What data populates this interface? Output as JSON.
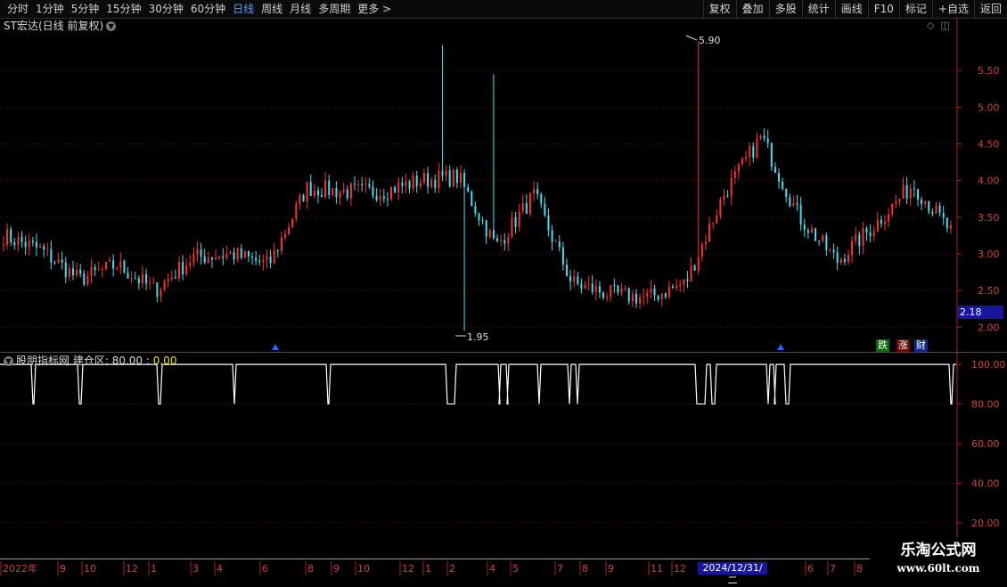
{
  "toolbar": {
    "periods": [
      "分时",
      "1分钟",
      "5分钟",
      "15分钟",
      "30分钟",
      "60分钟",
      "日线",
      "周线",
      "月线",
      "多周期",
      "更多 >"
    ],
    "active_period": "日线",
    "actions": [
      "复权",
      "叠加",
      "多股",
      "统计",
      "画线",
      "F10",
      "标记",
      "+自选",
      "返回"
    ]
  },
  "main_chart": {
    "title": "ST宏达(日线 前复权)",
    "price_axis": [
      "5.50",
      "5.00",
      "4.50",
      "4.00",
      "3.50",
      "3.00",
      "2.50",
      "2.00"
    ],
    "high_label": "5.90",
    "low_label": "1.95",
    "current_price": "2.18",
    "tags": [
      "跌",
      "涨",
      "财"
    ]
  },
  "indicator": {
    "name": "股朋指标网",
    "label": "建仓区: 80.00",
    "sep": " : ",
    "value": "0.00",
    "axis": [
      "100.00",
      "80.00",
      "60.00",
      "40.00",
      "20.00"
    ]
  },
  "time_axis": {
    "labels": [
      "2022年",
      "9",
      "10",
      "12",
      "1",
      "3",
      "4",
      "6",
      "8",
      "9",
      "10",
      "12",
      "1",
      "2",
      "4",
      "5",
      "7",
      "8",
      "9",
      "11",
      "12",
      "6",
      "7",
      "8"
    ],
    "cursor_date": "2024/12/31/二"
  },
  "watermark": {
    "line1": "乐淘公式网",
    "line2": "www.60lt.com"
  },
  "chart_data": [
    {
      "type": "candlestick",
      "title": "ST宏达(日线 前复权)",
      "ylim": [
        1.7,
        6.0
      ],
      "annotations": [
        {
          "label": "5.90",
          "kind": "high"
        },
        {
          "label": "1.95",
          "kind": "low"
        }
      ],
      "x": [
        "2022-08",
        "2022-09",
        "2022-10",
        "2022-12",
        "2023-01",
        "2023-03",
        "2023-04",
        "2023-06",
        "2023-08",
        "2023-09",
        "2023-10",
        "2023-12",
        "2024-01",
        "2024-02",
        "2024-04",
        "2024-05",
        "2024-07",
        "2024-08",
        "2024-09",
        "2024-11",
        "2024-12",
        "2025-02",
        "2025-04",
        "2025-06",
        "2025-07",
        "2025-08"
      ],
      "close": [
        3.25,
        3.05,
        2.65,
        2.85,
        2.5,
        2.95,
        3.0,
        2.85,
        3.9,
        3.85,
        3.85,
        4.0,
        4.05,
        3.1,
        3.8,
        2.6,
        2.45,
        2.4,
        2.6,
        3.8,
        4.6,
        3.5,
        2.9,
        3.4,
        3.95,
        3.3
      ]
    },
    {
      "type": "line",
      "title": "股朋指标网",
      "ylim": [
        15,
        105
      ],
      "series": [
        {
          "name": "建仓区",
          "values": [
            100,
            80,
            100,
            80,
            100,
            80,
            100,
            80,
            100,
            80,
            100,
            80,
            100,
            80,
            100,
            80,
            100,
            80,
            100,
            80,
            100,
            80,
            100,
            80,
            100,
            80,
            100,
            80,
            100,
            80,
            100,
            80,
            100,
            80,
            100,
            80,
            100,
            80,
            100,
            80,
            100,
            80,
            100,
            80
          ]
        }
      ]
    }
  ]
}
